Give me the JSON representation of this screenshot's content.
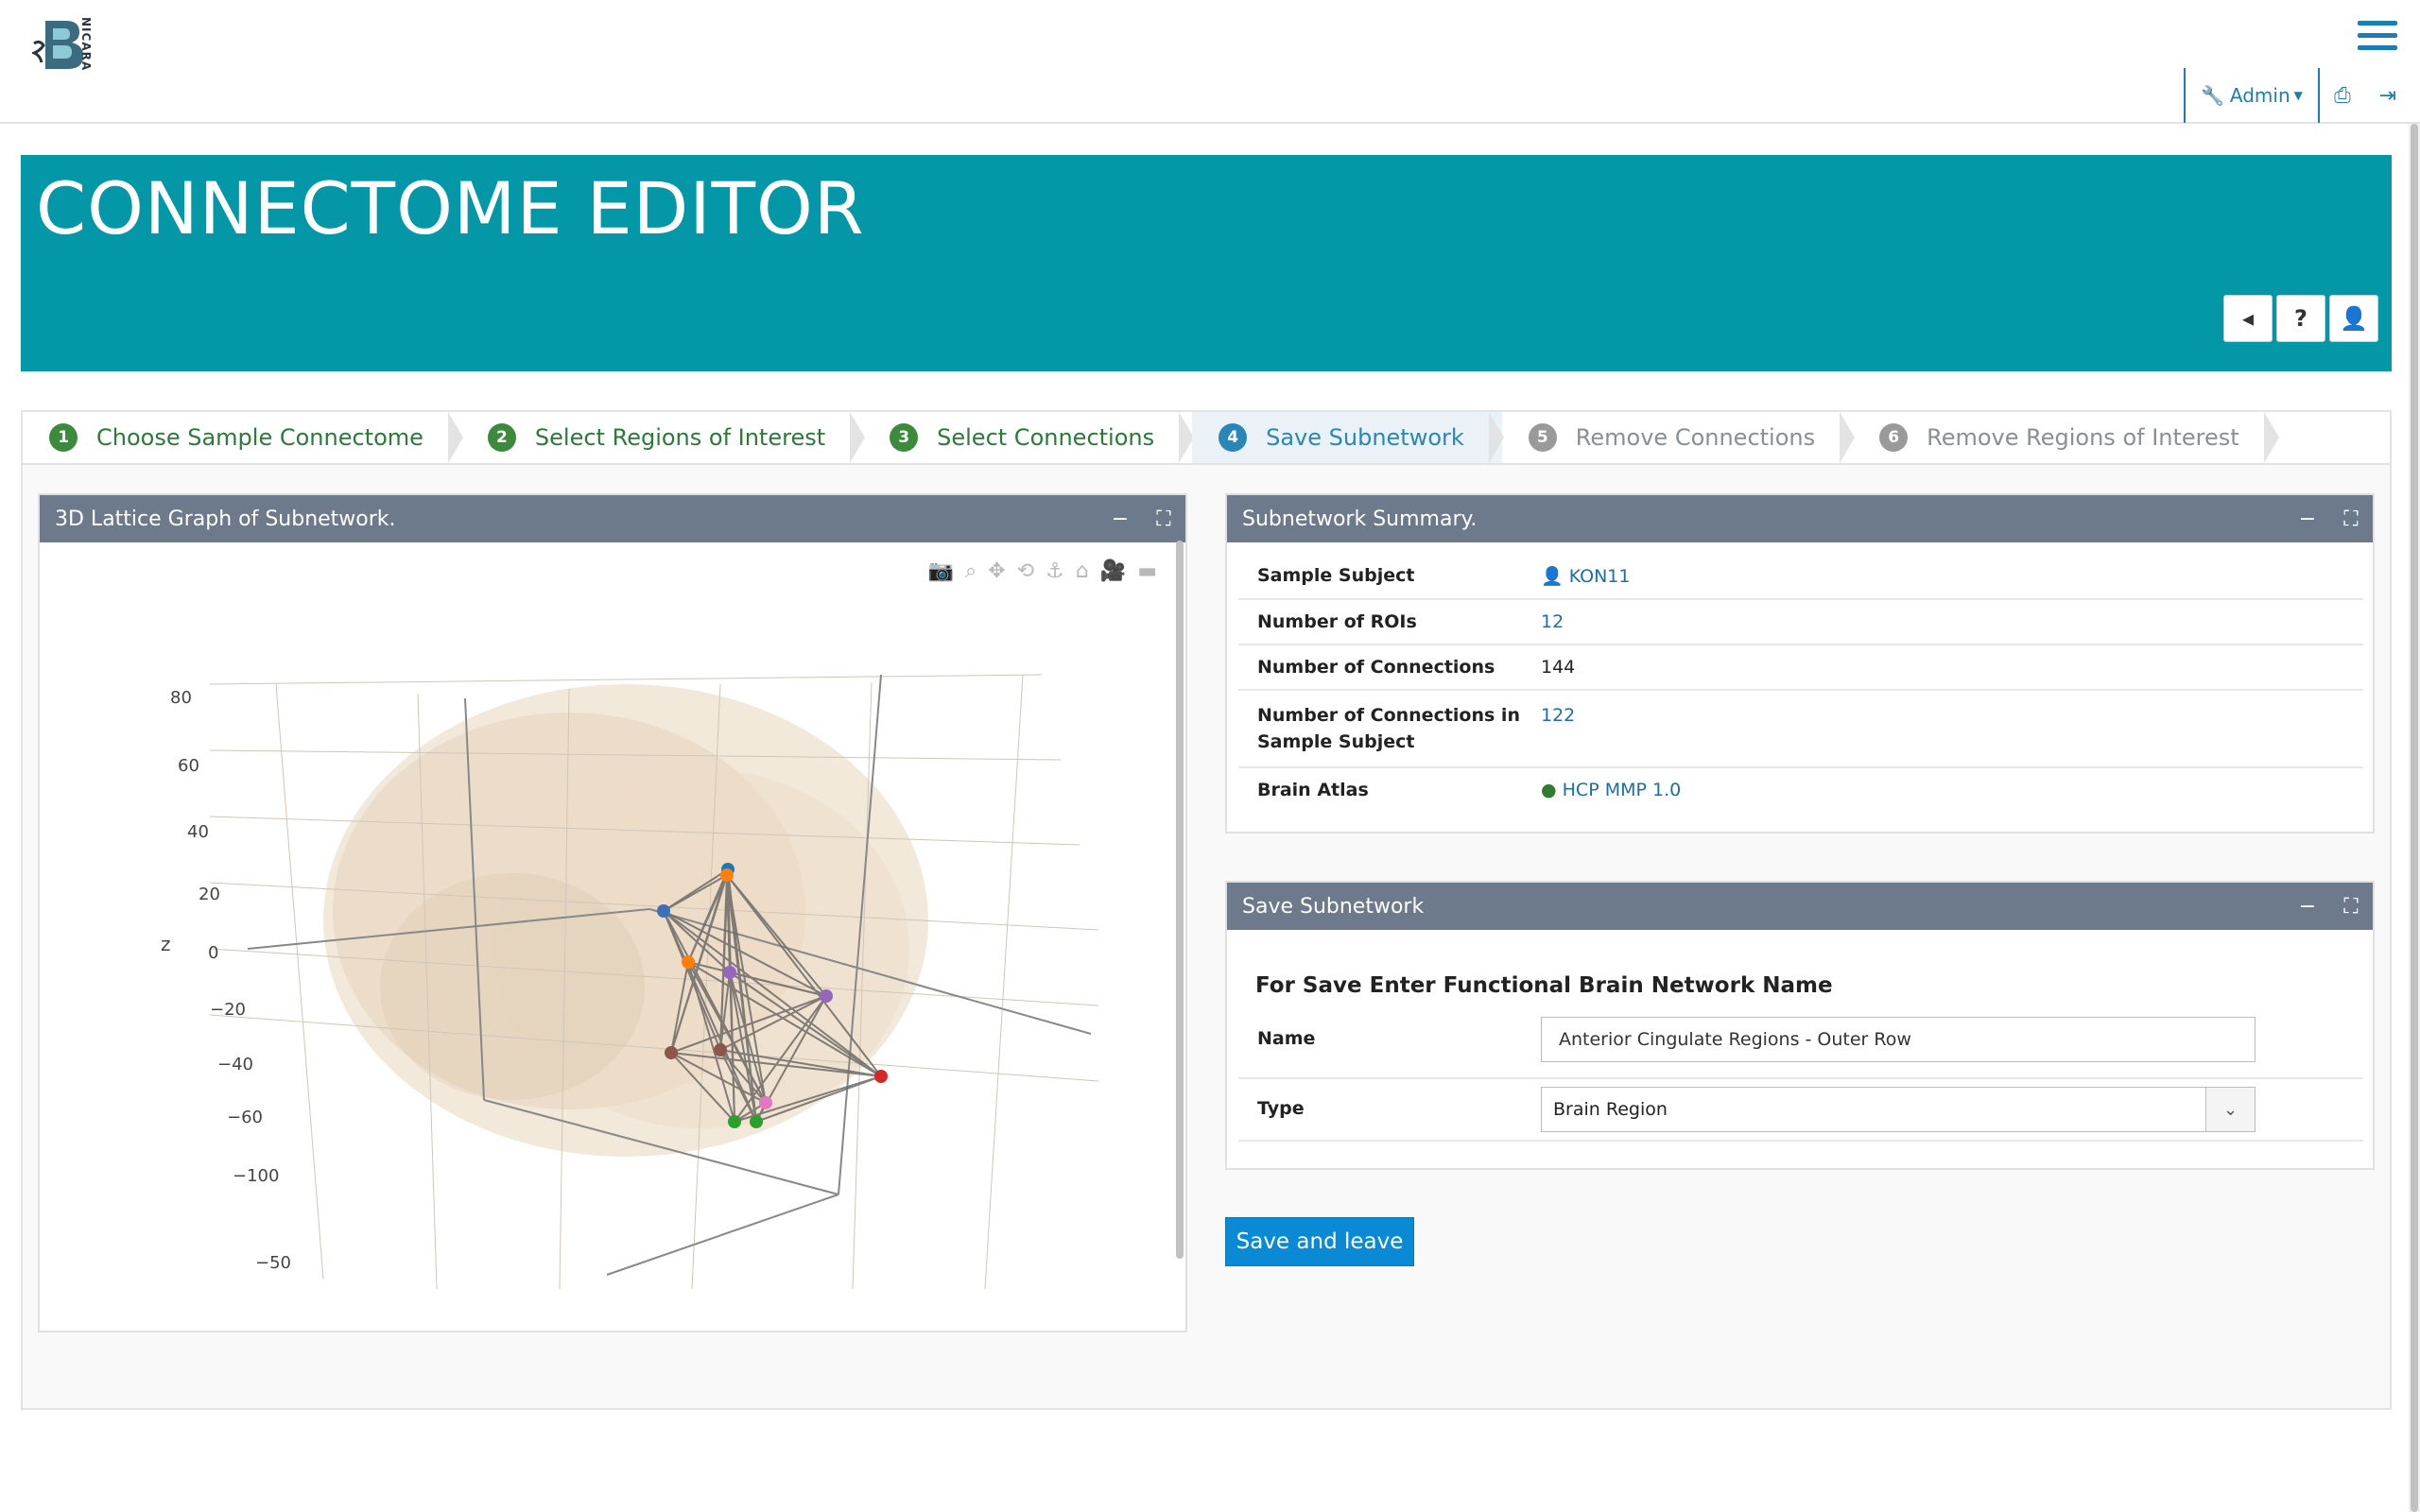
{
  "header": {
    "logo_text": "NICARA",
    "admin_label": "Admin"
  },
  "banner": {
    "title": "CONNECTOME EDITOR"
  },
  "steps": [
    {
      "num": "1",
      "label": "Choose Sample Connectome",
      "state": "done"
    },
    {
      "num": "2",
      "label": "Select Regions of Interest",
      "state": "done"
    },
    {
      "num": "3",
      "label": "Select Connections",
      "state": "done"
    },
    {
      "num": "4",
      "label": "Save Subnetwork",
      "state": "active"
    },
    {
      "num": "5",
      "label": "Remove Connections",
      "state": "todo"
    },
    {
      "num": "6",
      "label": "Remove Regions of Interest",
      "state": "todo"
    }
  ],
  "graph": {
    "title": "3D Lattice Graph of Subnetwork.",
    "z_axis_label": "z",
    "z_ticks": [
      "80",
      "60",
      "40",
      "20",
      "0",
      "−20",
      "−40",
      "−60",
      "−100",
      "−50"
    ]
  },
  "chart_data": {
    "type": "scatter",
    "nodes": 12,
    "node_colors": [
      "#3b6fb6",
      "#1f77b4",
      "#ff7f0e",
      "#9467bd",
      "#9467bd",
      "#8c564b",
      "#8c564b",
      "#d62728",
      "#2ca02c",
      "#2ca02c",
      "#e377c2",
      "#ff7f0e"
    ],
    "zlabel": "z"
  },
  "summary": {
    "title": "Subnetwork Summary.",
    "rows": [
      {
        "key": "Sample Subject",
        "value": "KON11"
      },
      {
        "key": "Number of ROIs",
        "value": "12"
      },
      {
        "key": "Number of Connections",
        "value": "144"
      },
      {
        "key": "Number of Connections in Sample Subject",
        "value": "122"
      },
      {
        "key": "Brain Atlas",
        "value": "HCP MMP 1.0"
      }
    ]
  },
  "save": {
    "title": "Save Subnetwork",
    "heading": "For Save Enter Functional Brain Network Name",
    "name_label": "Name",
    "name_value": "Anterior Cingulate Regions - Outer Row",
    "type_label": "Type",
    "type_value": "Brain Region",
    "button": "Save and leave"
  }
}
